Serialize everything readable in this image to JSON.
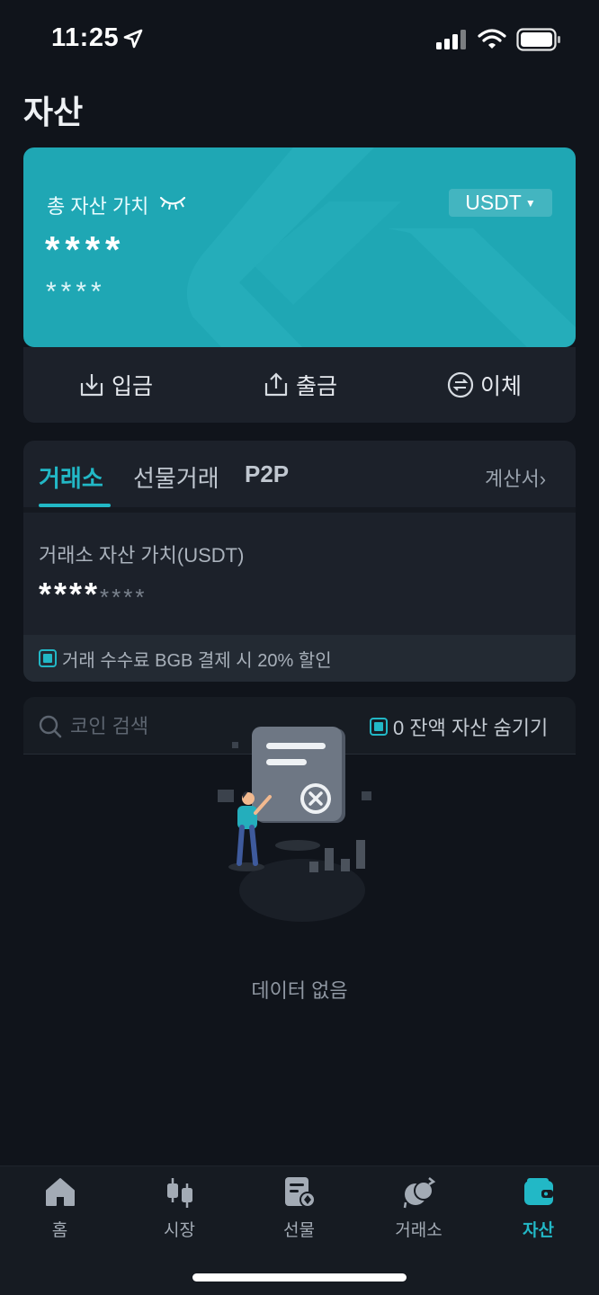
{
  "status_bar": {
    "time": "11:25"
  },
  "page_title": "자산",
  "asset_card": {
    "total_label": "총 자산 가치",
    "currency": "USDT",
    "masked_value": "****",
    "masked_sub_value": "****"
  },
  "actions": {
    "deposit": "입금",
    "withdraw": "출금",
    "transfer": "이체"
  },
  "tabs": {
    "items": [
      "거래소",
      "선물거래",
      "P2P"
    ],
    "active": "거래소",
    "statement": "계산서"
  },
  "exchange": {
    "label": "거래소 자산 가치(USDT)",
    "masked_value": "****",
    "masked_sub_value": "****",
    "fee_banner": "거래 수수료 BGB 결제 시 20% 할인"
  },
  "search": {
    "placeholder": "코인 검색",
    "hide_zero_label": "0 잔액 자산 숨기기"
  },
  "empty_text": "데이터 없음",
  "bottom_nav": {
    "items": [
      "홈",
      "시장",
      "선물",
      "거래소",
      "자산"
    ],
    "active": "자산"
  },
  "colors": {
    "accent": "#22b8c6",
    "card": "#1fa7b4",
    "background": "#10141b"
  }
}
